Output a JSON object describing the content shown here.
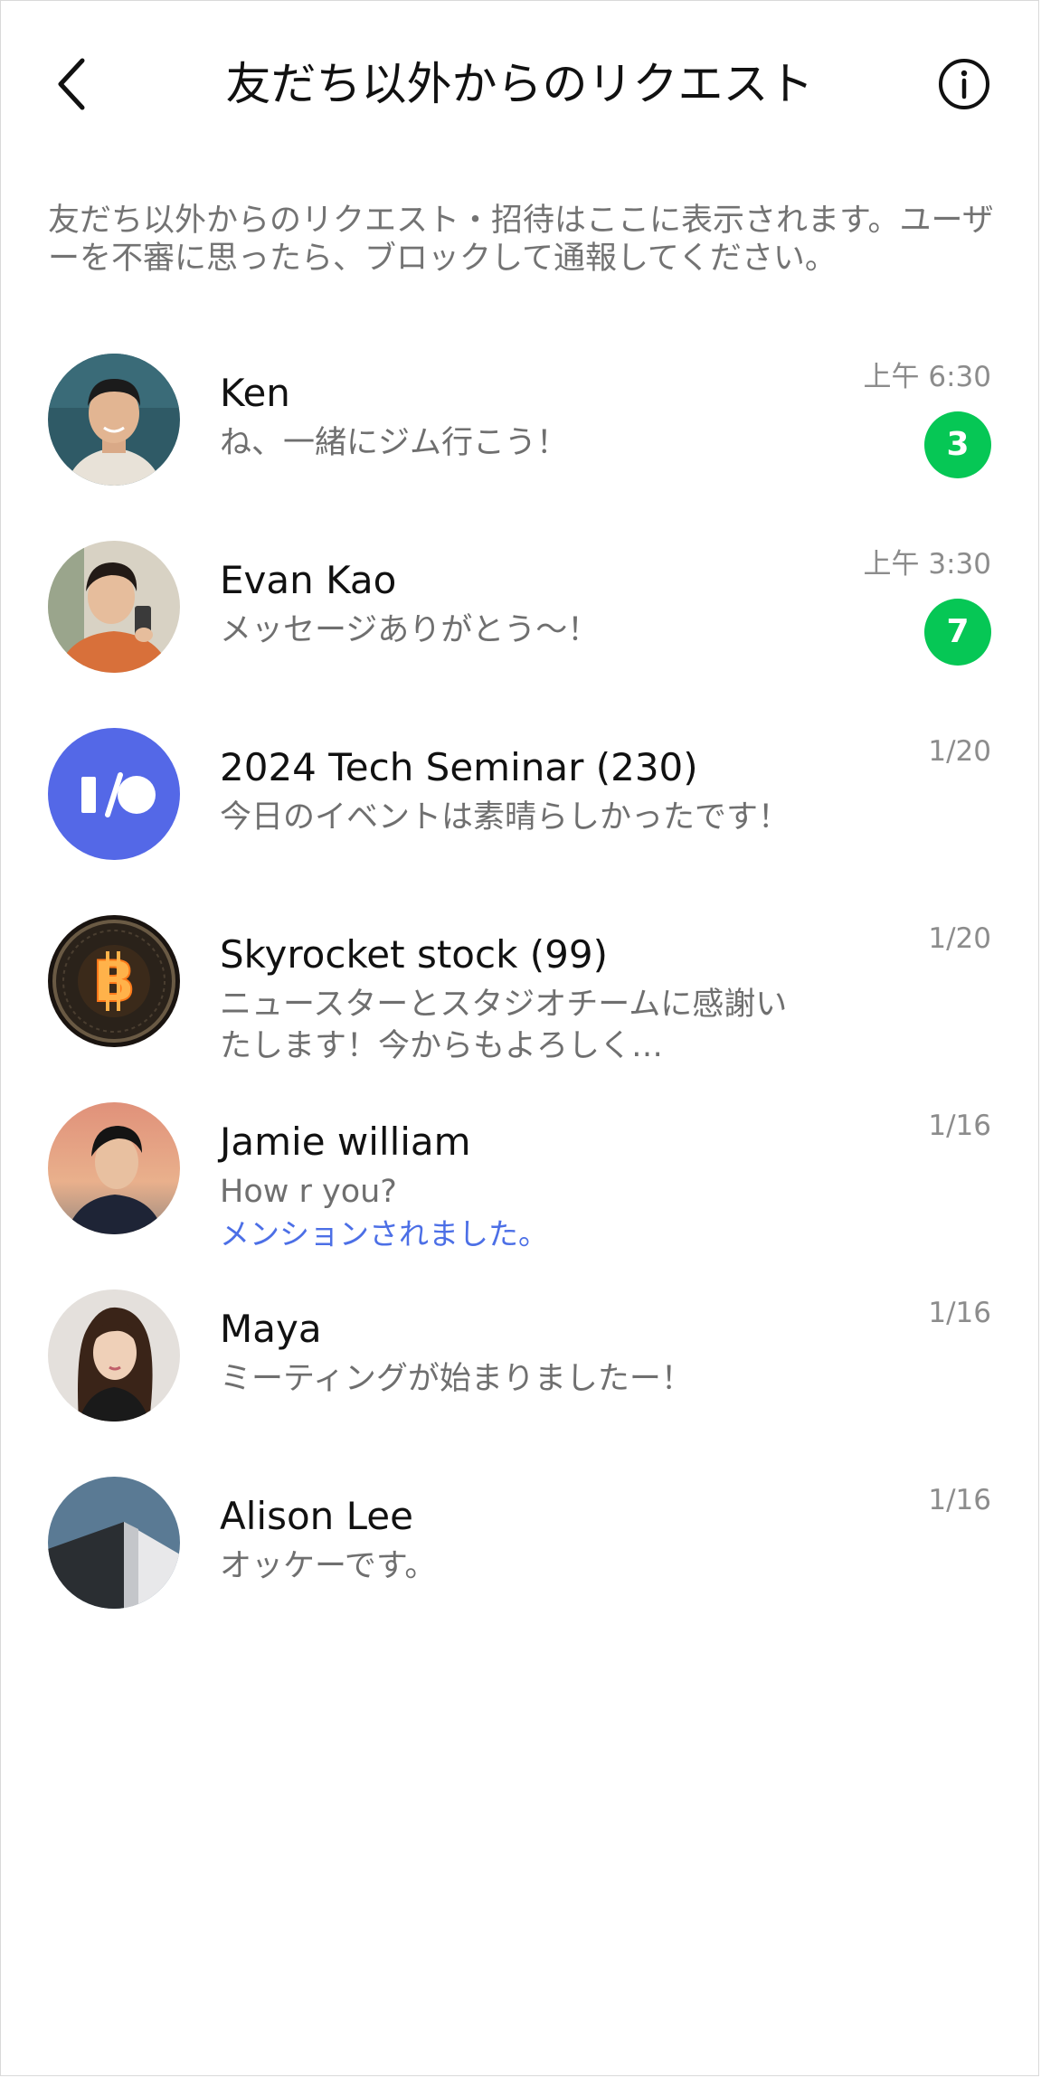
{
  "header": {
    "title": "友だち以外からのリクエスト"
  },
  "description": "友だち以外からのリクエスト・招待はここに表示されます。ユーザーを不審に思ったら、ブロックして通報してください。",
  "colors": {
    "badge": "#06c755",
    "mention": "#4c6fe6",
    "secondary_text": "#6f6f6f"
  },
  "chats": [
    {
      "name": "Ken",
      "message": "ね、一緒にジム行こう！",
      "time": "上午 6:30",
      "unread": "3",
      "avatar": "person-photo-avatar"
    },
    {
      "name": "Evan Kao",
      "message": "メッセージありがとう〜！",
      "time": "上午 3:30",
      "unread": "7",
      "avatar": "person-photo-avatar"
    },
    {
      "name": "2024 Tech Seminar (230)",
      "message": "今日のイベントは素晴らしかったです！",
      "time": "1/20",
      "avatar": "group-io-logo-avatar"
    },
    {
      "name": "Skyrocket stock (99)",
      "message": "ニュースターとスタジオチームに感謝いたします！今からもよろしく…",
      "time": "1/20",
      "avatar": "bitcoin-coin-avatar"
    },
    {
      "name": "Jamie william",
      "message": "How r you?",
      "mention": "メンションされました。",
      "time": "1/16",
      "avatar": "person-photo-avatar"
    },
    {
      "name": "Maya",
      "message": "ミーティングが始まりましたー！",
      "time": "1/16",
      "avatar": "person-photo-avatar"
    },
    {
      "name": "Alison Lee",
      "message": "オッケーです。",
      "time": "1/16",
      "avatar": "building-photo-avatar"
    }
  ]
}
